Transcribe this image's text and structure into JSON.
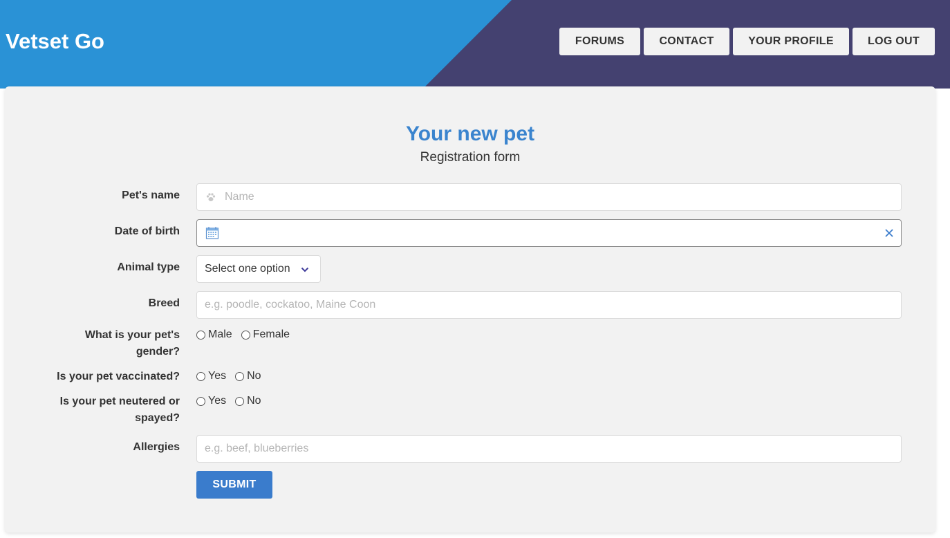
{
  "header": {
    "brand": "Vetset Go",
    "nav": [
      "FORUMS",
      "CONTACT",
      "YOUR PROFILE",
      "LOG OUT"
    ],
    "colors": {
      "left": "#2a92d6",
      "right": "#444170"
    }
  },
  "form": {
    "title": "Your new pet",
    "subtitle": "Registration form",
    "pet_name": {
      "label": "Pet's name",
      "placeholder": "Name",
      "value": ""
    },
    "dob": {
      "label": "Date of birth",
      "value": ""
    },
    "animal_type": {
      "label": "Animal type",
      "selected": "Select one option"
    },
    "breed": {
      "label": "Breed",
      "placeholder": "e.g. poodle, cockatoo, Maine Coon",
      "value": ""
    },
    "gender": {
      "label_line1": "What is your pet's",
      "label_line2": "gender?",
      "options": [
        "Male",
        "Female"
      ]
    },
    "vaccinated": {
      "label": "Is your pet vaccinated?",
      "options": [
        "Yes",
        "No"
      ]
    },
    "neutered": {
      "label_line1": "Is your pet neutered or",
      "label_line2": "spayed?",
      "options": [
        "Yes",
        "No"
      ]
    },
    "allergies": {
      "label": "Allergies",
      "placeholder": "e.g. beef, blueberries",
      "value": ""
    },
    "submit": "SUBMIT"
  },
  "accent_color": "#3a84ce"
}
